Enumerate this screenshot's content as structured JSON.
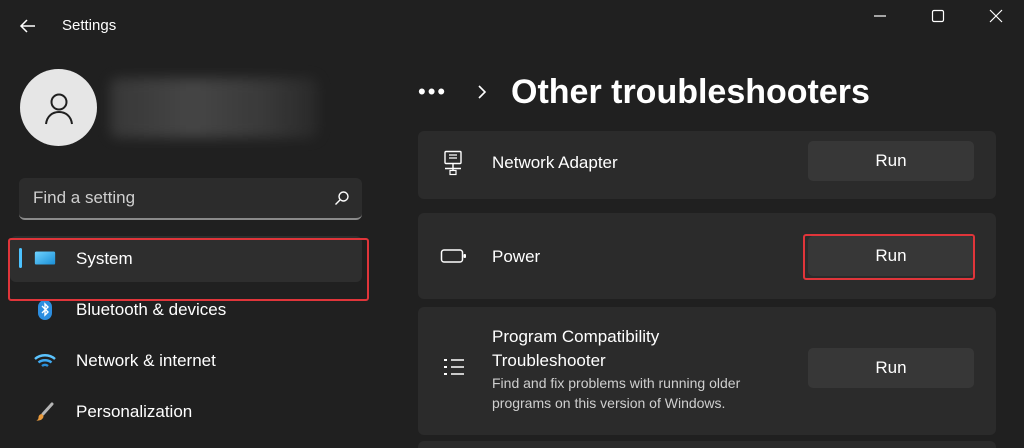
{
  "window": {
    "title": "Settings",
    "controls": [
      "minimize",
      "maximize",
      "close"
    ]
  },
  "sidebar": {
    "search": {
      "placeholder": "Find a setting"
    },
    "items": [
      {
        "label": "System",
        "icon": "monitor-icon",
        "active": true
      },
      {
        "label": "Bluetooth & devices",
        "icon": "bluetooth-icon",
        "active": false
      },
      {
        "label": "Network & internet",
        "icon": "wifi-icon",
        "active": false
      },
      {
        "label": "Personalization",
        "icon": "brush-icon",
        "active": false
      }
    ]
  },
  "main": {
    "breadcrumb_more": "•••",
    "title": "Other troubleshooters",
    "troubleshooters": [
      {
        "title": "Network Adapter",
        "icon": "network-adapter-icon",
        "button": "Run"
      },
      {
        "title": "Power",
        "icon": "battery-icon",
        "button": "Run"
      },
      {
        "title_line1": "Program Compatibility",
        "title_line2": "Troubleshooter",
        "desc_line1": "Find and fix problems with running older",
        "desc_line2": "programs on this version of Windows.",
        "icon": "list-icon",
        "button": "Run"
      }
    ]
  },
  "colors": {
    "background": "#202020",
    "card": "#2b2b2b",
    "button": "#373737",
    "accent": "#4cc2ff",
    "highlight": "#e0353a"
  }
}
